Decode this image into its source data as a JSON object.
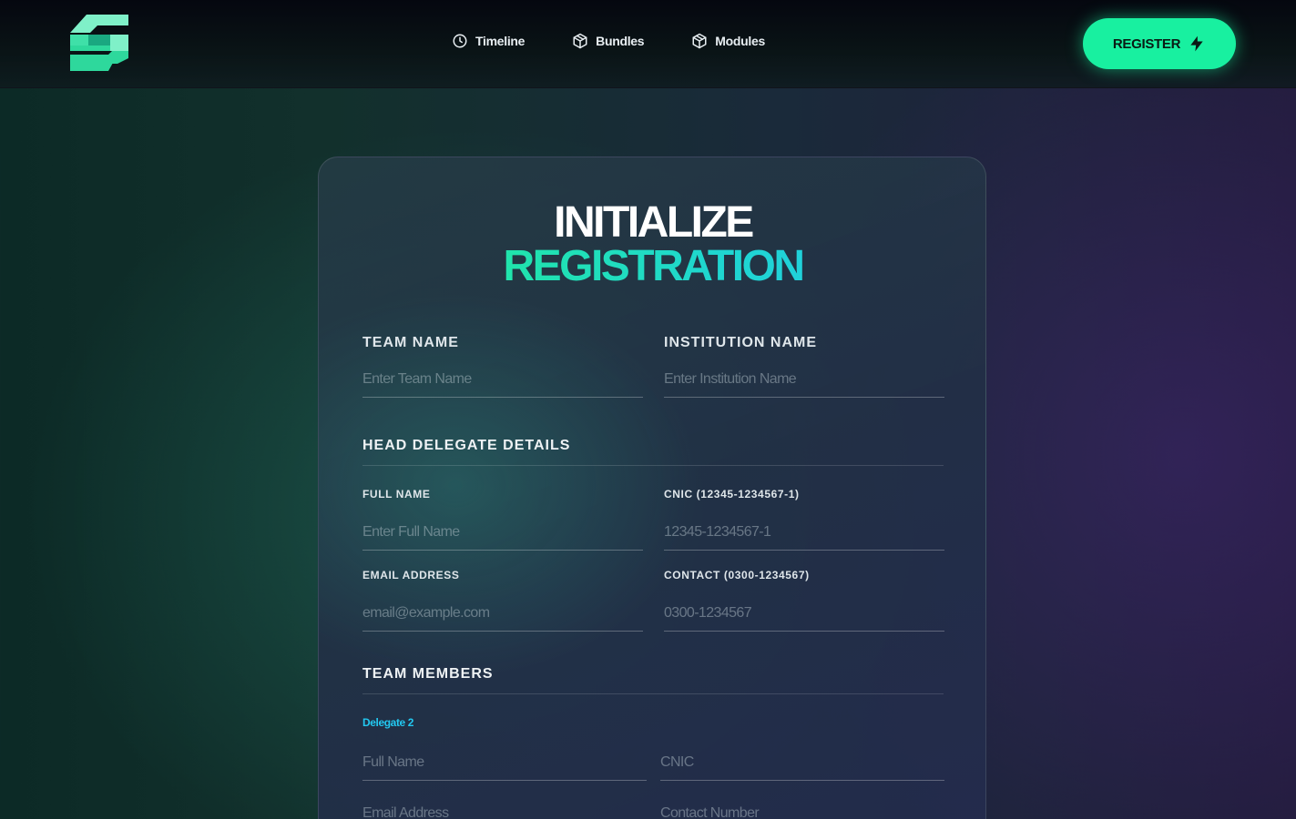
{
  "header": {
    "nav": [
      {
        "label": "Timeline",
        "icon": "clock-icon"
      },
      {
        "label": "Bundles",
        "icon": "box-icon"
      },
      {
        "label": "Modules",
        "icon": "box-icon"
      }
    ],
    "register_label": "REGISTER",
    "register_icon": "lightning-icon"
  },
  "form": {
    "title_line1": "INITIALIZE",
    "title_line2": "REGISTRATION",
    "team_name": {
      "label": "TEAM NAME",
      "placeholder": "Enter Team Name",
      "value": ""
    },
    "institution_name": {
      "label": "INSTITUTION NAME",
      "placeholder": "Enter Institution Name",
      "value": ""
    },
    "head_delegate": {
      "section_title": "HEAD DELEGATE DETAILS",
      "full_name": {
        "label": "FULL NAME",
        "placeholder": "Enter Full Name",
        "value": ""
      },
      "cnic": {
        "label": "CNIC (12345-1234567-1)",
        "placeholder": "12345-1234567-1",
        "value": ""
      },
      "email": {
        "label": "EMAIL ADDRESS",
        "placeholder": "email@example.com",
        "value": ""
      },
      "contact": {
        "label": "CONTACT (0300-1234567)",
        "placeholder": "0300-1234567",
        "value": ""
      }
    },
    "team_members": {
      "section_title": "TEAM MEMBERS",
      "delegate_label": "Delegate 2",
      "full_name_placeholder": "Full Name",
      "cnic_placeholder": "CNIC",
      "email_placeholder": "Email Address",
      "contact_placeholder": "Contact Number"
    }
  },
  "colors": {
    "accent_green": "#18f0a0",
    "accent_cyan": "#22c8f0"
  }
}
